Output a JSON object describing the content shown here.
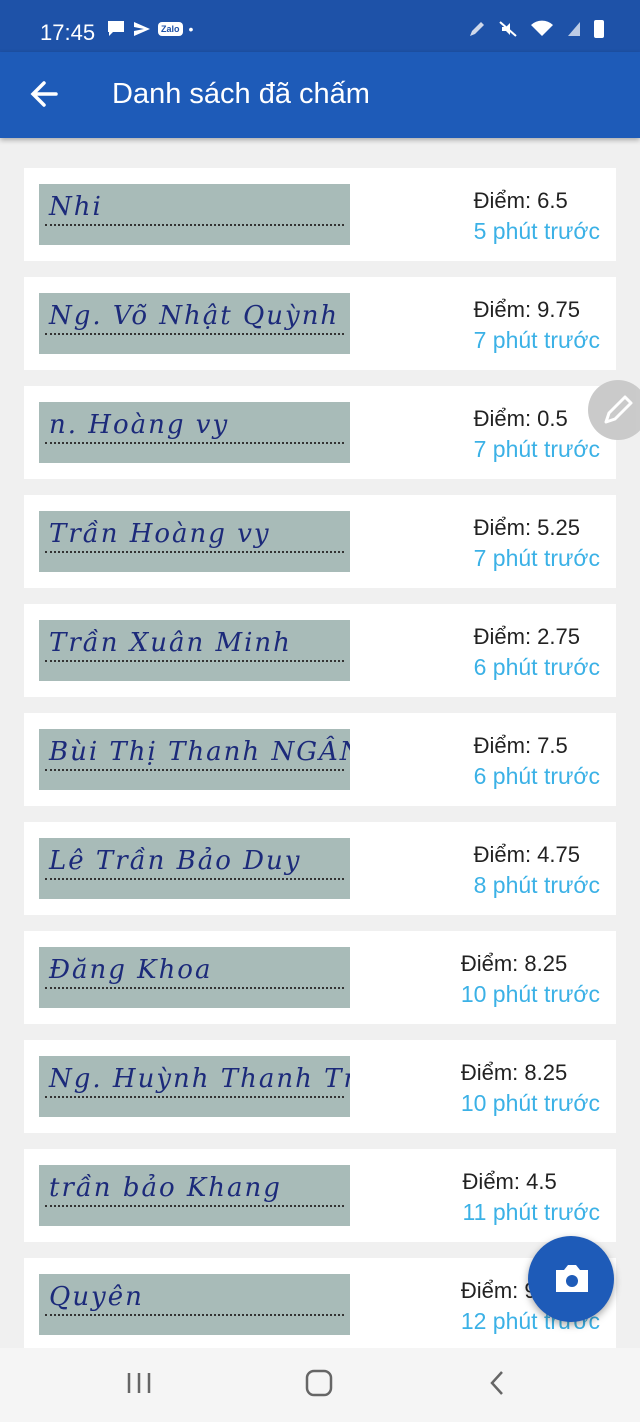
{
  "status": {
    "time": "17:45",
    "notification_icons": [
      "chat-bubble-icon",
      "send-icon",
      "zalo-icon"
    ],
    "zalo_label": "Zalo",
    "dot": "•",
    "right_icons": [
      "pen-icon",
      "mute-icon",
      "wifi-icon",
      "signal-icon",
      "battery-icon"
    ]
  },
  "appbar": {
    "title": "Danh sách đã chấm"
  },
  "items": [
    {
      "name": "Nhi",
      "score": "Điểm: 6.5",
      "ago": "5 phút trước"
    },
    {
      "name": "Ng. Võ Nhật Quỳnh",
      "score": "Điểm: 9.75",
      "ago": "7 phút trước"
    },
    {
      "name": "n. Hoàng vy",
      "score": "Điểm: 0.5",
      "ago": "7 phút trước"
    },
    {
      "name": "Trần Hoàng vy",
      "score": "Điểm: 5.25",
      "ago": "7 phút trước"
    },
    {
      "name": "Trần Xuân Minh",
      "score": "Điểm: 2.75",
      "ago": "6 phút trước"
    },
    {
      "name": "Bùi Thị Thanh NGÂN",
      "score": "Điểm: 7.5",
      "ago": "6 phút trước"
    },
    {
      "name": "Lê Trần Bảo Duy",
      "score": "Điểm: 4.75",
      "ago": "8 phút trước"
    },
    {
      "name": "Đăng Khoa",
      "score": "Điểm: 8.25",
      "ago": "10 phút trước"
    },
    {
      "name": "Ng. Huỳnh Thanh Trúc",
      "score": "Điểm: 8.25",
      "ago": "10 phút trước"
    },
    {
      "name": "trần bảo Khang",
      "score": "Điểm: 4.5",
      "ago": "11 phút trước"
    },
    {
      "name": "Quyên",
      "score": "Điểm: 9",
      "ago": "12 phút trước"
    }
  ],
  "colors": {
    "primary": "#1e5bb8",
    "link": "#3bb1e6",
    "background": "#f0f0f0"
  }
}
